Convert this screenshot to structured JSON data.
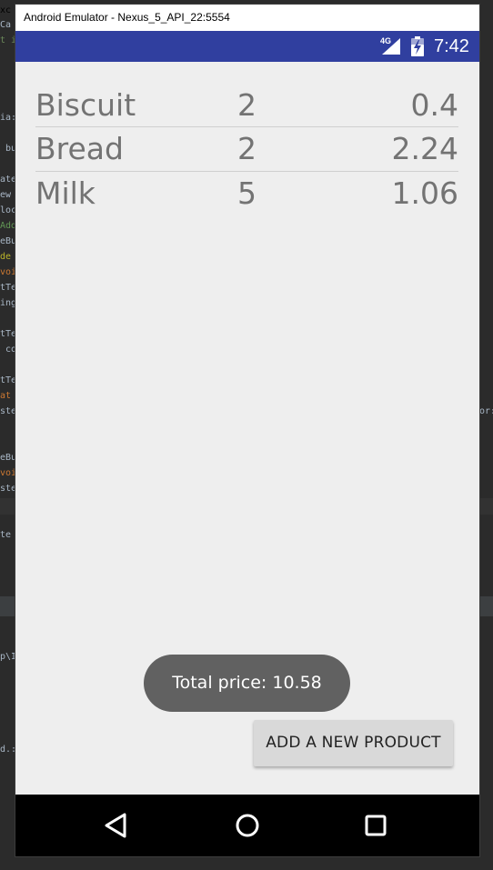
{
  "background_ide": {
    "fragments": [
      {
        "text": "xc",
        "cls": "c-def",
        "pos": "a"
      },
      {
        "text": "Ca",
        "cls": "c-def",
        "pos": "b"
      },
      {
        "text": "t i",
        "cls": "c-str",
        "pos": "c"
      },
      {
        "text": "ia:",
        "cls": "c-def",
        "pos": "d"
      },
      {
        "text": " bu",
        "cls": "c-def",
        "pos": "e"
      },
      {
        "text": "ate",
        "cls": "c-def",
        "pos": "f"
      },
      {
        "text": "ew",
        "cls": "c-def",
        "pos": "g"
      },
      {
        "text": "loc",
        "cls": "c-def",
        "pos": "h"
      },
      {
        "text": "Add",
        "cls": "c-cm",
        "pos": "i"
      },
      {
        "text": "eBu",
        "cls": "c-def",
        "pos": "j"
      },
      {
        "text": "de",
        "cls": "c-ann",
        "pos": "k"
      },
      {
        "text": "voi",
        "cls": "c-kw",
        "pos": "l"
      },
      {
        "text": "tTe",
        "cls": "c-def",
        "pos": "m"
      },
      {
        "text": "ing",
        "cls": "c-def",
        "pos": "n"
      },
      {
        "text": "tTe",
        "cls": "c-def",
        "pos": "o"
      },
      {
        "text": " co",
        "cls": "c-def",
        "pos": "p"
      },
      {
        "text": "tTe",
        "cls": "c-def",
        "pos": "q"
      },
      {
        "text": "at",
        "cls": "c-kw",
        "pos": "r"
      },
      {
        "text": "ste",
        "cls": "c-def",
        "pos": "s"
      },
      {
        "text": "eBu",
        "cls": "c-def",
        "pos": "t"
      },
      {
        "text": "voi",
        "cls": "c-kw",
        "pos": "u"
      },
      {
        "text": "ste",
        "cls": "c-def",
        "pos": "v"
      },
      {
        "text": "te",
        "cls": "c-def",
        "pos": "w"
      },
      {
        "text": "p\\I",
        "cls": "c-def",
        "pos": "x"
      },
      {
        "text": "d.:",
        "cls": "c-def",
        "pos": "y"
      },
      {
        "text": "or:",
        "cls": "c-def",
        "pos": "z"
      }
    ]
  },
  "window": {
    "title": "Android Emulator - Nexus_5_API_22:5554"
  },
  "status_bar": {
    "network": "4G",
    "time": "7:42",
    "color": "#303f9f"
  },
  "products": [
    {
      "name": "Biscuit",
      "qty": "2",
      "price": "0.4"
    },
    {
      "name": "Bread",
      "qty": "2",
      "price": "2.24"
    },
    {
      "name": "Milk",
      "qty": "5",
      "price": "1.06"
    }
  ],
  "toast": {
    "text": "Total price: 10.58"
  },
  "add_button": {
    "label": "ADD A NEW PRODUCT"
  },
  "nav_bar": {
    "back_icon": "back-triangle-icon",
    "home_icon": "home-circle-icon",
    "recents_icon": "recents-square-icon"
  }
}
